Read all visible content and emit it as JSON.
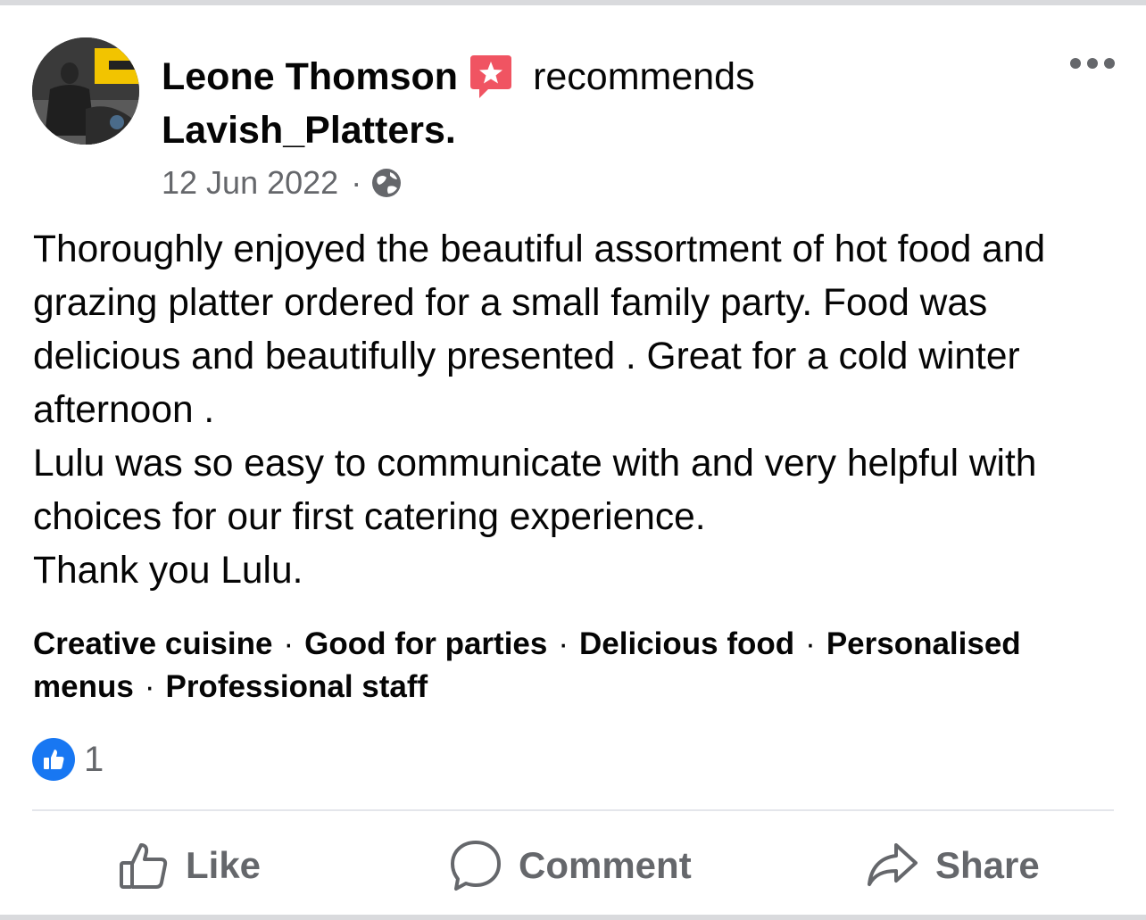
{
  "post": {
    "author": "Leone Thomson",
    "action_text": "recommends",
    "page_name": "Lavish_Platters.",
    "date": "12 Jun 2022",
    "meta_separator": "·",
    "body_paragraphs": [
      "Thoroughly enjoyed the beautiful assortment of hot food and grazing platter ordered for a small family party. Food was delicious and beautifully presented . Great for a cold winter afternoon .",
      "Lulu was so easy to communicate with and very helpful with choices for our first catering experience.",
      "Thank you Lulu."
    ],
    "tags": [
      "Creative cuisine",
      "Good for parties",
      "Delicious food",
      "Personalised menus",
      "Professional staff"
    ],
    "tag_separator": "·",
    "reaction_count": "1"
  },
  "actions": {
    "like": "Like",
    "comment": "Comment",
    "share": "Share"
  },
  "icons": {
    "recommend": "recommend-star-icon",
    "audience": "globe-icon",
    "more": "more-options-icon",
    "reaction": "like-reaction-icon",
    "like": "thumbs-up-icon",
    "comment": "comment-bubble-icon",
    "share": "share-arrow-icon"
  },
  "colors": {
    "recommend_icon": "#f05462",
    "like_blue": "#1877f2",
    "secondary_text": "#65676b"
  }
}
